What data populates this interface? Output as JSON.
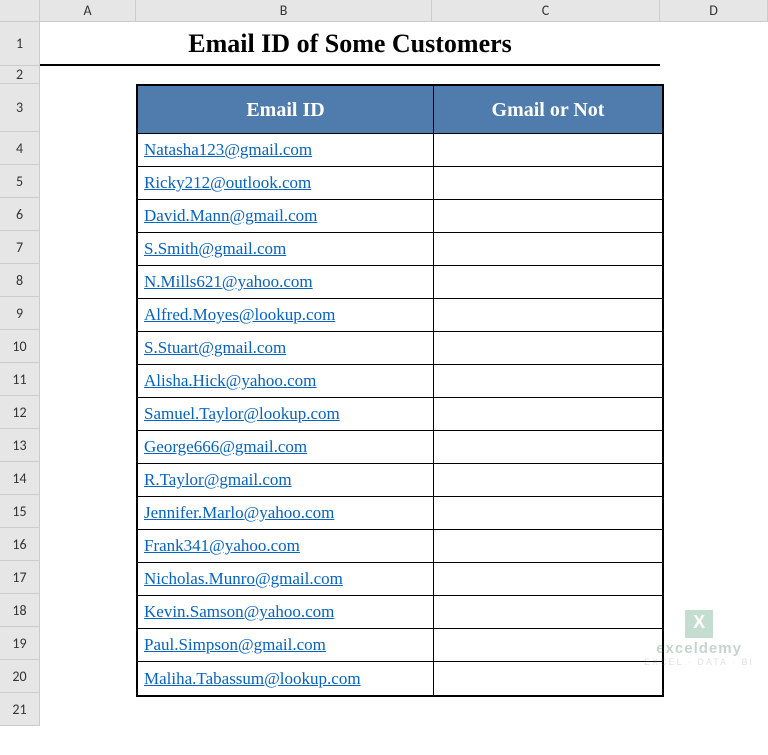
{
  "columns": {
    "A": "A",
    "B": "B",
    "C": "C",
    "D": "D"
  },
  "rowlabels": [
    "1",
    "2",
    "3",
    "4",
    "5",
    "6",
    "7",
    "8",
    "9",
    "10",
    "11",
    "12",
    "13",
    "14",
    "15",
    "16",
    "17",
    "18",
    "19",
    "20",
    "21"
  ],
  "title": "Email ID of Some Customers",
  "headers": {
    "emailid": "Email ID",
    "gmailornot": "Gmail or Not"
  },
  "rows": [
    {
      "email": "Natasha123@gmail.com",
      "gmail": ""
    },
    {
      "email": "Ricky212@outlook.com",
      "gmail": ""
    },
    {
      "email": "David.Mann@gmail.com",
      "gmail": ""
    },
    {
      "email": "S.Smith@gmail.com",
      "gmail": ""
    },
    {
      "email": "N.Mills621@yahoo.com",
      "gmail": ""
    },
    {
      "email": "Alfred.Moyes@lookup.com",
      "gmail": ""
    },
    {
      "email": "S.Stuart@gmail.com",
      "gmail": ""
    },
    {
      "email": "Alisha.Hick@yahoo.com",
      "gmail": ""
    },
    {
      "email": "Samuel.Taylor@lookup.com",
      "gmail": ""
    },
    {
      "email": "George666@gmail.com",
      "gmail": ""
    },
    {
      "email": "R.Taylor@gmail.com",
      "gmail": ""
    },
    {
      "email": "Jennifer.Marlo@yahoo.com",
      "gmail": ""
    },
    {
      "email": "Frank341@yahoo.com",
      "gmail": ""
    },
    {
      "email": "Nicholas.Munro@gmail.com",
      "gmail": ""
    },
    {
      "email": "Kevin.Samson@yahoo.com",
      "gmail": ""
    },
    {
      "email": "Paul.Simpson@gmail.com",
      "gmail": ""
    },
    {
      "email": "Maliha.Tabassum@lookup.com",
      "gmail": ""
    }
  ],
  "watermark": {
    "brand": "exceldemy",
    "tag": "EXCEL · DATA · BI"
  }
}
